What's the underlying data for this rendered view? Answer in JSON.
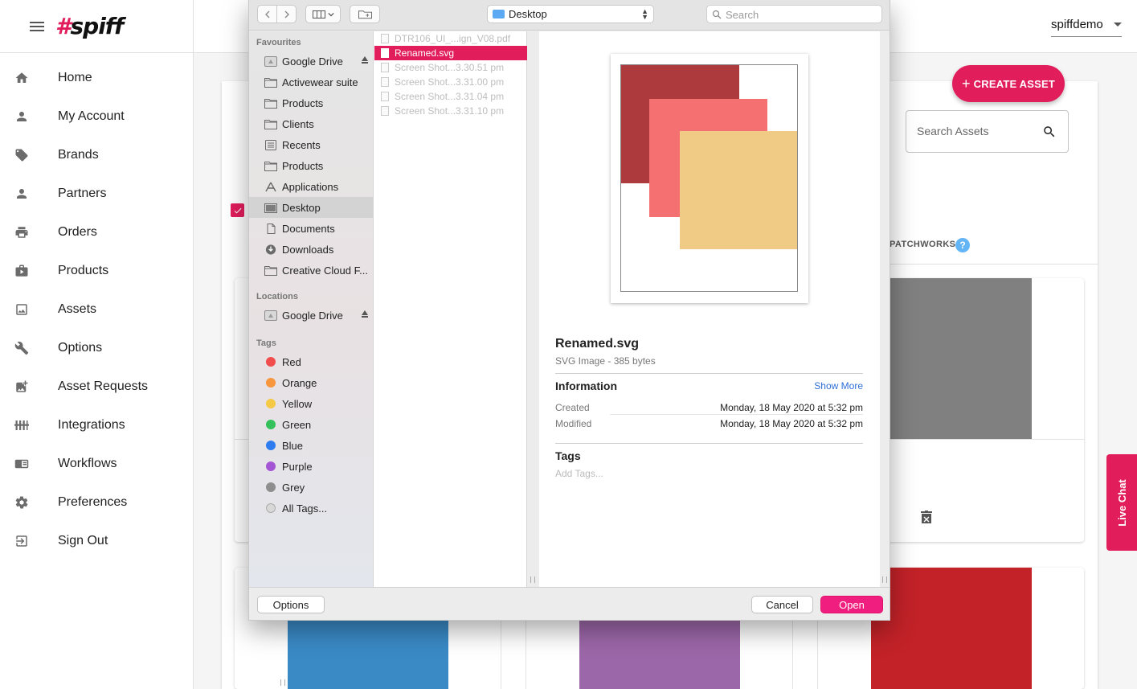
{
  "app": {
    "logo_hash": "#",
    "logo_text": "spiff",
    "user": "spiffdemo",
    "create_label": "CREATE ASSET",
    "search_placeholder": "Search Assets",
    "patchworks_label": "PATCHWORKS",
    "help_glyph": "?",
    "live_chat": "Live Chat",
    "accent": "#e11d5c"
  },
  "nav": [
    {
      "label": "Home",
      "icon": "home-icon"
    },
    {
      "label": "My Account",
      "icon": "person-icon"
    },
    {
      "label": "Brands",
      "icon": "tag-icon"
    },
    {
      "label": "Partners",
      "icon": "person-icon"
    },
    {
      "label": "Orders",
      "icon": "printer-icon"
    },
    {
      "label": "Products",
      "icon": "box-icon"
    },
    {
      "label": "Assets",
      "icon": "image-icon"
    },
    {
      "label": "Options",
      "icon": "wrench-icon"
    },
    {
      "label": "Asset Requests",
      "icon": "add-image-icon"
    },
    {
      "label": "Integrations",
      "icon": "integrations-icon"
    },
    {
      "label": "Workflows",
      "icon": "workflow-icon"
    },
    {
      "label": "Preferences",
      "icon": "gear-icon"
    },
    {
      "label": "Sign Out",
      "icon": "sign-out-icon"
    }
  ],
  "cards": {
    "swatch_colors": [
      "#808080",
      "#3a8ac6",
      "#9c67a8",
      "#c22228"
    ]
  },
  "dialog": {
    "location": "Desktop",
    "search_placeholder": "Search",
    "favourites_heading": "Favourites",
    "favourites": [
      {
        "label": "Google Drive",
        "icon": "drive-icon",
        "eject": true
      },
      {
        "label": "Activewear suite",
        "icon": "folder-icon"
      },
      {
        "label": "Products",
        "icon": "folder-icon"
      },
      {
        "label": "Clients",
        "icon": "folder-icon"
      },
      {
        "label": "Recents",
        "icon": "recents-icon"
      },
      {
        "label": "Products",
        "icon": "folder-icon"
      },
      {
        "label": "Applications",
        "icon": "applications-icon"
      },
      {
        "label": "Desktop",
        "icon": "desktop-icon",
        "selected": true
      },
      {
        "label": "Documents",
        "icon": "documents-icon"
      },
      {
        "label": "Downloads",
        "icon": "downloads-icon"
      },
      {
        "label": "Creative Cloud F...",
        "icon": "folder-icon"
      }
    ],
    "locations_heading": "Locations",
    "locations": [
      {
        "label": "Google Drive",
        "icon": "drive-icon",
        "eject": true
      }
    ],
    "tags_heading": "Tags",
    "tags": [
      {
        "label": "Red",
        "color": "#f24d4d"
      },
      {
        "label": "Orange",
        "color": "#f7963c"
      },
      {
        "label": "Yellow",
        "color": "#f5c945"
      },
      {
        "label": "Green",
        "color": "#34c05a"
      },
      {
        "label": "Blue",
        "color": "#2e7cf0"
      },
      {
        "label": "Purple",
        "color": "#a355d3"
      },
      {
        "label": "Grey",
        "color": "#8e8e8e"
      },
      {
        "label": "All Tags...",
        "color": "#d8d8d8"
      }
    ],
    "files": [
      {
        "name": "DTR106_UI_...ign_V08.pdf",
        "selected": false
      },
      {
        "name": "Renamed.svg",
        "selected": true
      },
      {
        "name": "Screen Shot...3.30.51 pm",
        "selected": false
      },
      {
        "name": "Screen Shot...3.31.00 pm",
        "selected": false
      },
      {
        "name": "Screen Shot...3.31.04 pm",
        "selected": false
      },
      {
        "name": "Screen Shot...3.31.10 pm",
        "selected": false
      }
    ],
    "preview": {
      "name": "Renamed.svg",
      "kind": "SVG Image - 385 bytes",
      "info_heading": "Information",
      "show_more": "Show More",
      "created_label": "Created",
      "created_value": "Monday, 18 May 2020 at 5:32 pm",
      "modified_label": "Modified",
      "modified_value": "Monday, 18 May 2020 at 5:32 pm",
      "tags_heading": "Tags",
      "add_tags_placeholder": "Add Tags...",
      "shape_colors": [
        "#ad3a3d",
        "#f57070",
        "#f0cb85"
      ]
    },
    "options_label": "Options",
    "cancel_label": "Cancel",
    "open_label": "Open"
  }
}
